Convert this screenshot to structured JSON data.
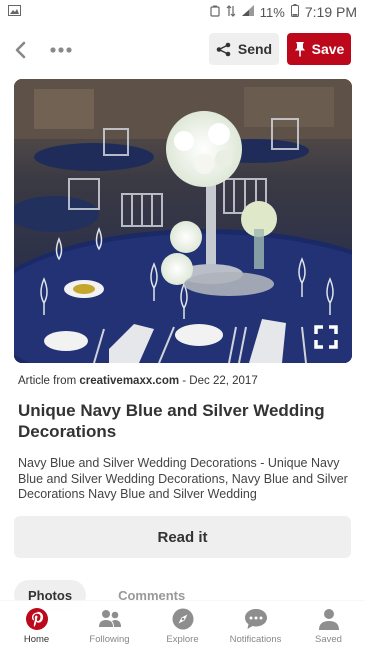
{
  "status_bar": {
    "battery": "11%",
    "time": "7:19 PM"
  },
  "action_bar": {
    "send_label": "Send",
    "save_label": "Save"
  },
  "article": {
    "source_prefix": "Article from ",
    "source_domain": "creativemaxx.com",
    "source_date": " - Dec 22, 2017",
    "title": "Unique Navy Blue and Silver Wedding Decorations",
    "description": "Navy Blue and Silver Wedding Decorations - Unique Navy Blue and Silver Wedding Decorations, Navy Blue and Silver Decorations Navy Blue and Silver Wedding",
    "read_label": "Read it"
  },
  "tabs": [
    {
      "label": "Photos"
    },
    {
      "label": "Comments"
    }
  ],
  "bottom_nav": [
    {
      "label": "Home"
    },
    {
      "label": "Following"
    },
    {
      "label": "Explore"
    },
    {
      "label": "Notifications"
    },
    {
      "label": "Saved"
    }
  ],
  "colors": {
    "brand_red": "#bd081c",
    "button_gray": "#efefef"
  }
}
